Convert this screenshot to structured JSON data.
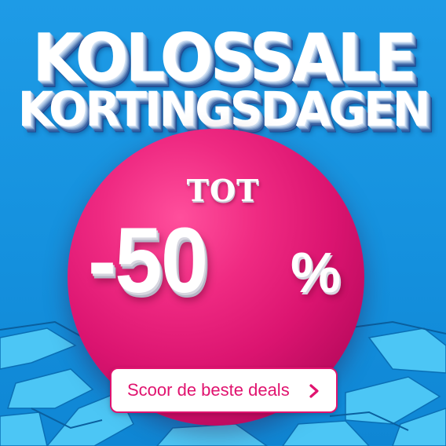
{
  "headline": {
    "line1": "KOLOSSALE",
    "line2": "KORTINGSDAGEN"
  },
  "promo": {
    "prefix": "TOT",
    "discount": "-50",
    "percent_sign": "%"
  },
  "cta": {
    "label": "Scoor de beste deals",
    "icon": "chevron-right-icon"
  },
  "colors": {
    "background": "#1591de",
    "ball": "#e0136f",
    "cta_text": "#e0136f",
    "cta_border": "#e0136f",
    "headline_text": "#ffffff"
  }
}
